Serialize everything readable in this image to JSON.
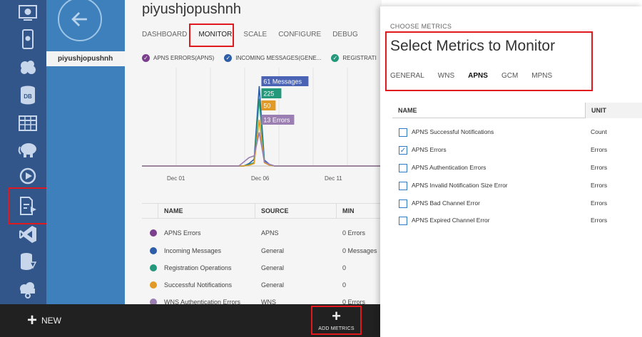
{
  "app": {
    "title": "piyushjopushnh",
    "side_item": "piyushjopushnh"
  },
  "tabs": [
    {
      "label": "DASHBOARD"
    },
    {
      "label": "MONITOR",
      "active": true
    },
    {
      "label": "SCALE"
    },
    {
      "label": "CONFIGURE"
    },
    {
      "label": "DEBUG"
    }
  ],
  "legend": [
    {
      "label": "APNS ERRORS(APNS)",
      "color": "#7b3f8e"
    },
    {
      "label": "INCOMING MESSAGES(GENE...",
      "color": "#2e5ea8"
    },
    {
      "label": "REGISTRATI",
      "color": "#23987a"
    }
  ],
  "chart_data": {
    "type": "line",
    "x_tick_labels": [
      "Dec 01",
      "Dec 06",
      "Dec 11"
    ],
    "data_labels": [
      {
        "text": "61 Messages",
        "color": "#4a63b5"
      },
      {
        "text": "225",
        "color": "#23987a"
      },
      {
        "text": "50",
        "color": "#e19a26"
      },
      {
        "text": "13 Errors",
        "color": "#9b7fb2"
      }
    ],
    "series": [
      {
        "color": "#2e5ea8",
        "points": [
          0,
          0,
          0,
          0,
          0,
          0,
          0,
          0,
          0,
          0,
          0,
          0,
          0,
          0,
          0,
          0,
          0,
          0,
          0,
          0,
          0,
          0.03,
          0.08,
          0.95,
          0.07,
          0.02,
          0,
          0,
          0,
          0,
          0,
          0,
          0,
          0,
          0,
          0,
          0,
          0,
          0,
          0,
          0,
          0,
          0,
          0,
          0,
          0,
          0,
          0
        ]
      },
      {
        "color": "#23987a",
        "points": [
          0,
          0,
          0,
          0,
          0,
          0,
          0,
          0,
          0,
          0,
          0,
          0,
          0,
          0,
          0,
          0,
          0,
          0,
          0,
          0,
          0,
          0.02,
          0.04,
          0.8,
          0.05,
          0.01,
          0,
          0,
          0,
          0,
          0,
          0,
          0,
          0,
          0,
          0,
          0,
          0,
          0,
          0,
          0,
          0,
          0,
          0,
          0,
          0,
          0,
          0
        ]
      },
      {
        "color": "#e19a26",
        "points": [
          0,
          0,
          0,
          0,
          0,
          0,
          0,
          0,
          0,
          0,
          0,
          0,
          0,
          0,
          0,
          0,
          0,
          0,
          0,
          0,
          0,
          0.01,
          0.03,
          0.55,
          0.04,
          0.01,
          0,
          0,
          0,
          0,
          0,
          0,
          0,
          0,
          0,
          0,
          0,
          0,
          0,
          0,
          0,
          0,
          0,
          0,
          0,
          0,
          0,
          0
        ]
      },
      {
        "color": "#9b7fb2",
        "points": [
          0,
          0,
          0,
          0,
          0,
          0,
          0,
          0,
          0,
          0,
          0,
          0,
          0,
          0,
          0,
          0,
          0,
          0,
          0,
          0,
          0.05,
          0.1,
          0.12,
          0.4,
          0.05,
          0.02,
          0,
          0,
          0,
          0,
          0,
          0,
          0,
          0,
          0,
          0,
          0,
          0,
          0,
          0,
          0,
          0,
          0,
          0,
          0,
          0,
          0,
          0
        ]
      }
    ]
  },
  "metrics_table": {
    "headers": [
      "NAME",
      "SOURCE",
      "MIN"
    ],
    "rows": [
      {
        "name": "APNS Errors",
        "source": "APNS",
        "min": "0 Errors",
        "color": "#7b3f8e"
      },
      {
        "name": "Incoming Messages",
        "source": "General",
        "min": "0 Messages",
        "color": "#2e5ea8"
      },
      {
        "name": "Registration Operations",
        "source": "General",
        "min": "0",
        "color": "#23987a"
      },
      {
        "name": "Successful Notifications",
        "source": "General",
        "min": "0",
        "color": "#e19a26"
      },
      {
        "name": "WNS Authentication Errors",
        "source": "WNS",
        "min": "0 Errors",
        "color": "#9b7fb2"
      }
    ]
  },
  "bottom_bar": {
    "new_label": "NEW",
    "add_metrics_label": "ADD METRICS"
  },
  "dialog": {
    "label": "CHOOSE METRICS",
    "title": "Select Metrics to Monitor",
    "tabs": [
      {
        "label": "GENERAL"
      },
      {
        "label": "WNS"
      },
      {
        "label": "APNS",
        "active": true
      },
      {
        "label": "GCM"
      },
      {
        "label": "MPNS"
      }
    ],
    "col_name": "NAME",
    "col_unit": "UNIT",
    "metrics": [
      {
        "name": "APNS Successful Notifications",
        "unit": "Count",
        "checked": false
      },
      {
        "name": "APNS Errors",
        "unit": "Errors",
        "checked": true
      },
      {
        "name": "APNS Authentication Errors",
        "unit": "Errors",
        "checked": false
      },
      {
        "name": "APNS Invalid Notification Size Error",
        "unit": "Errors",
        "checked": false
      },
      {
        "name": "APNS Bad Channel Error",
        "unit": "Errors",
        "checked": false
      },
      {
        "name": "APNS Expired Channel Error",
        "unit": "Errors",
        "checked": false
      }
    ]
  },
  "colors": {
    "rail": "#32558a",
    "accent_blue": "#3d80bb",
    "highlight_red": "#e0191f"
  }
}
